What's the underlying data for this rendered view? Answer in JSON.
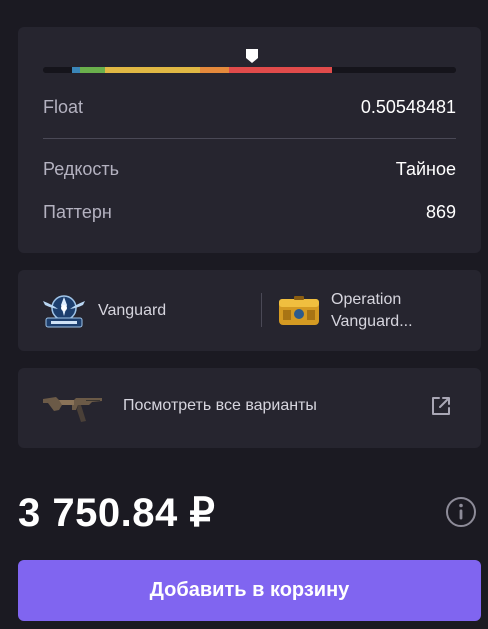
{
  "float": {
    "label": "Float",
    "value": "0.50548481",
    "marker_fraction": 0.505,
    "segments": [
      {
        "name": "factory-new",
        "from": 0,
        "to": 0.07,
        "color": "#15141b"
      },
      {
        "name": "minimal-wear",
        "from": 0.07,
        "to": 0.09,
        "color": "#3a86b8"
      },
      {
        "name": "field-tested-low",
        "from": 0.09,
        "to": 0.15,
        "color": "#6ab04c"
      },
      {
        "name": "field-tested",
        "from": 0.15,
        "to": 0.38,
        "color": "#e0b844"
      },
      {
        "name": "well-worn",
        "from": 0.38,
        "to": 0.45,
        "color": "#e58a3c"
      },
      {
        "name": "battle-scarred",
        "from": 0.45,
        "to": 0.7,
        "color": "#e04b4b"
      },
      {
        "name": "rest",
        "from": 0.7,
        "to": 1.0,
        "color": "#15141b"
      }
    ]
  },
  "details": {
    "rarity_label": "Редкость",
    "rarity_value": "Тайное",
    "pattern_label": "Паттерн",
    "pattern_value": "869"
  },
  "collection": {
    "name": "Vanguard",
    "case_line1": "Operation",
    "case_line2": "Vanguard..."
  },
  "variants": {
    "label": "Посмотреть все варианты"
  },
  "price": "3 750.84 ₽",
  "cart_button_label": "Добавить в корзину",
  "colors": {
    "accent": "#8065f0",
    "card": "#26252f",
    "background": "#1b1a22"
  }
}
